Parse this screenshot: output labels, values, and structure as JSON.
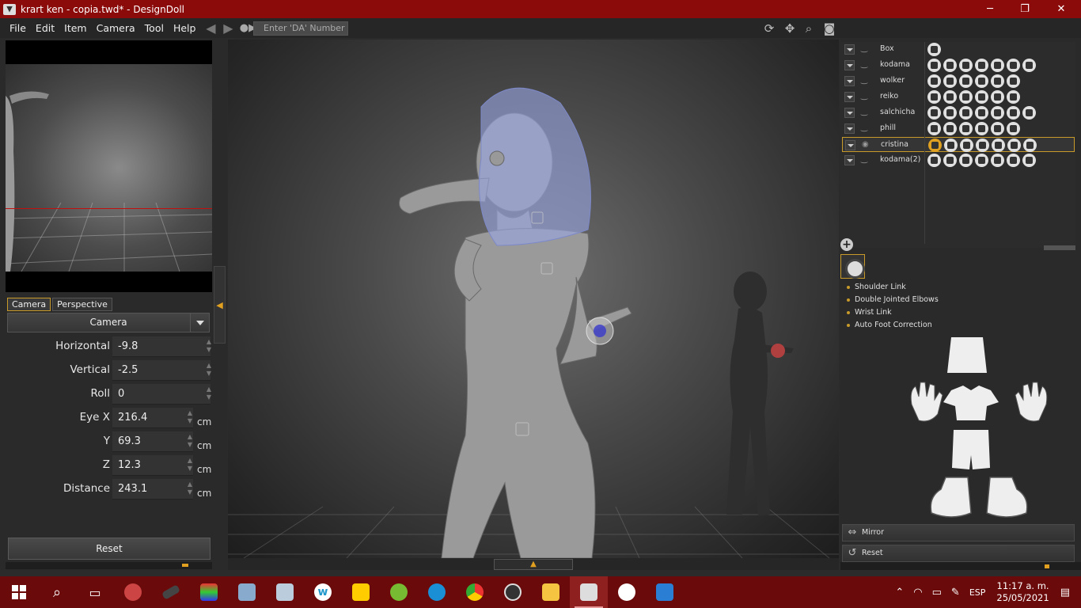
{
  "window": {
    "title": "krart ken - copia.twd* - DesignDoll",
    "controls": {
      "minimize": "─",
      "maximize": "❐",
      "close": "✕"
    }
  },
  "menu": {
    "items": [
      "File",
      "Edit",
      "Item",
      "Camera",
      "Tool",
      "Help"
    ],
    "da_placeholder": "Enter 'DA' Number"
  },
  "left": {
    "tabs": [
      "Camera",
      "Perspective"
    ],
    "camera_select": "Camera",
    "fields": [
      {
        "label": "Horizontal",
        "value": "-9.8",
        "unit": ""
      },
      {
        "label": "Vertical",
        "value": "-2.5",
        "unit": ""
      },
      {
        "label": "Roll",
        "value": "0",
        "unit": ""
      },
      {
        "label": "Eye X",
        "value": "216.4",
        "unit": "cm"
      },
      {
        "label": "Y",
        "value": "69.3",
        "unit": "cm"
      },
      {
        "label": "Z",
        "value": "12.3",
        "unit": "cm"
      },
      {
        "label": "Distance",
        "value": "243.1",
        "unit": "cm"
      }
    ],
    "reset": "Reset"
  },
  "outliner": {
    "items": [
      {
        "name": "Box",
        "selected": false
      },
      {
        "name": "kodama",
        "selected": false
      },
      {
        "name": "wolker",
        "selected": false
      },
      {
        "name": "reiko",
        "selected": false
      },
      {
        "name": "salchicha",
        "selected": false
      },
      {
        "name": "phill",
        "selected": false
      },
      {
        "name": "cristina",
        "selected": true
      },
      {
        "name": "kodama(2)",
        "selected": false
      }
    ]
  },
  "options": {
    "items": [
      "Shoulder Link",
      "Double Jointed Elbows",
      "Wrist Link",
      "Auto Foot Correction"
    ]
  },
  "right_buttons": {
    "mirror": "Mirror",
    "reset": "Reset"
  },
  "tray": {
    "language": "ESP",
    "time": "11:17 a. m.",
    "date": "25/05/2021"
  },
  "colors": {
    "titlebar": "#8b0a0a",
    "taskbar": "#6a0a0a",
    "accent": "#c79a2a"
  }
}
